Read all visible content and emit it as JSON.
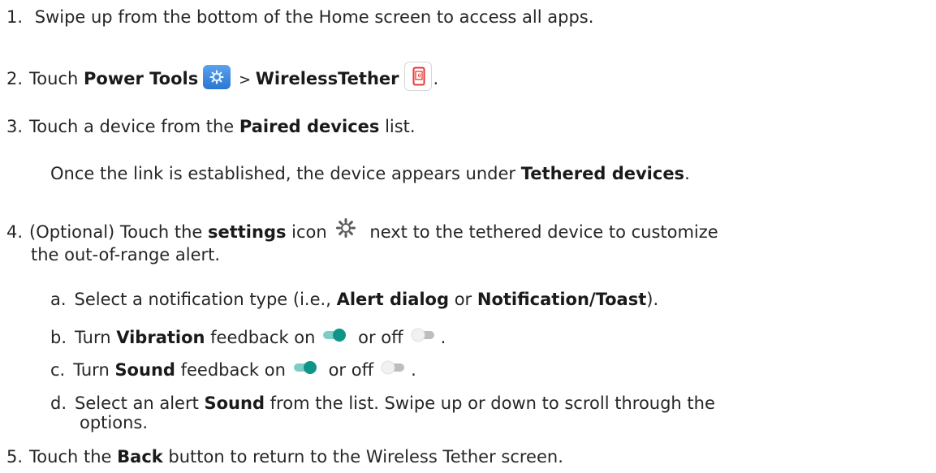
{
  "steps": [
    {
      "num": "1.",
      "text": "Swipe up from the bottom of the Home screen to access all apps."
    },
    {
      "num": "2.",
      "pre": "Touch ",
      "b1": "Power Tools",
      "sep": " > ",
      "b2": "WirelessTether",
      "post": "."
    },
    {
      "num": "3.",
      "pre": "Touch a device from the ",
      "b1": "Paired devices",
      "post": " list."
    },
    {
      "note_pre": "Once the link is established, the device appears under ",
      "note_b": "Tethered devices",
      "note_post": "."
    },
    {
      "num": "4.",
      "pre": "(Optional) Touch the ",
      "b1": "settings",
      "mid": " icon",
      "post": " next to the tethered device to customize",
      "line2": "the out-of-range alert."
    },
    {
      "num": "5.",
      "pre": "Touch the ",
      "b1": "Back",
      "post": " button to return to the Wireless Tether screen."
    }
  ],
  "substeps": [
    {
      "letter": "a.",
      "pre": "Select a notification type (i.e., ",
      "b1": "Alert dialog",
      "mid": " or ",
      "b2": "Notification/Toast",
      "post": ")."
    },
    {
      "letter": "b.",
      "pre": "Turn ",
      "b1": "Vibration",
      "mid": " feedback on",
      "mid2": " or off",
      "post": "."
    },
    {
      "letter": "c.",
      "pre": "Turn ",
      "b1": "Sound",
      "mid": " feedback on",
      "mid2": " or off",
      "post": "."
    },
    {
      "letter": "d.",
      "pre": "Select an alert ",
      "b1": "Sound",
      "post": " from the list. Swipe up or down to scroll through the",
      "line2": "options."
    }
  ],
  "icons": {
    "power_tools": "power-tools-app-icon",
    "wireless_tether": "wireless-tether-app-icon",
    "settings": "gear-icon",
    "toggle_on": "toggle-on-icon",
    "toggle_off": "toggle-off-icon"
  },
  "colors": {
    "text": "#262626",
    "toggle_on": "#0e9488",
    "toggle_track_on": "#7ccdc6",
    "toggle_off": "#e9e9e9",
    "power_tools_bg": "#3a86de",
    "wireless_tether_accent": "#e53935"
  }
}
